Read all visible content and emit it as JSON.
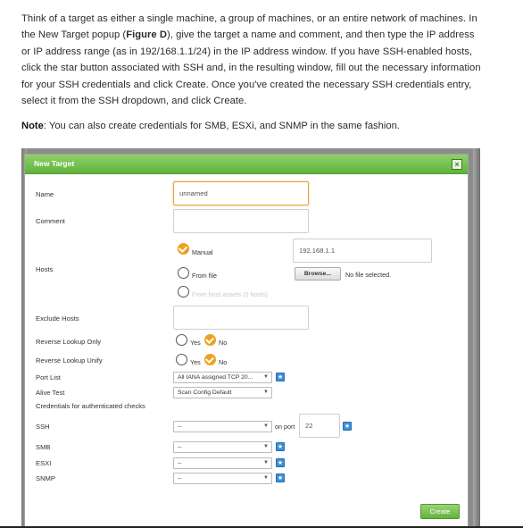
{
  "article": {
    "paragraph_1a": "Think of a target as either a single machine, a group of machines, or an entire network of machines. In the New Target popup (",
    "paragraph_1_figure": "Figure D",
    "paragraph_1b": "), give the target a name and comment, and then type the IP address or IP address range (as in 192/168.1.1/24) in the IP address window. If you have SSH-enabled hosts, click the star button associated with SSH and, in the resulting window, fill out the necessary information for your SSH credentials and click Create. Once you've created the necessary SSH credentials entry, select it from the SSH dropdown, and click Create.",
    "note_label": "Note",
    "note_text": ": You can also create credentials for SMB, ESXi, and SNMP in the same fashion."
  },
  "dialog": {
    "title": "New Target",
    "close_glyph": "×",
    "labels": {
      "name": "Name",
      "comment": "Comment",
      "hosts": "Hosts",
      "exclude_hosts": "Exclude Hosts",
      "reverse_lookup_only": "Reverse Lookup Only",
      "reverse_lookup_unify": "Reverse Lookup Unify",
      "port_list": "Port List",
      "alive_test": "Alive Test",
      "credentials_heading": "Credentials for authenticated checks",
      "ssh": "SSH",
      "smb": "SMB",
      "esxi": "ESXI",
      "snmp": "SNMP"
    },
    "fields": {
      "name_value": "unnamed",
      "comment_value": "",
      "hosts_manual_value": "192.168.1.1",
      "exclude_hosts_value": "",
      "ssh_port_value": "22"
    },
    "hosts_options": {
      "manual": "Manual",
      "from_file": "From file",
      "from_host_assets": "From host assets (0 hosts)",
      "browse_label": "Browse...",
      "no_file": "No file selected."
    },
    "yes_no": {
      "yes": "Yes",
      "no": "No"
    },
    "selects": {
      "port_list": "All IANA assigned TCP 20...",
      "alive_test": "Scan Config Default",
      "ssh": "--",
      "smb": "--",
      "esxi": "--",
      "snmp": "--"
    },
    "on_port_label": "on port",
    "star_glyph": "★",
    "arrow_glyph": "▼",
    "create_label": "Create"
  },
  "colors": {
    "titlebar": "#6cbf45",
    "focus_border": "#e8a33a",
    "radio_selected": "#f0a020",
    "star_button": "#3b8fd6"
  }
}
